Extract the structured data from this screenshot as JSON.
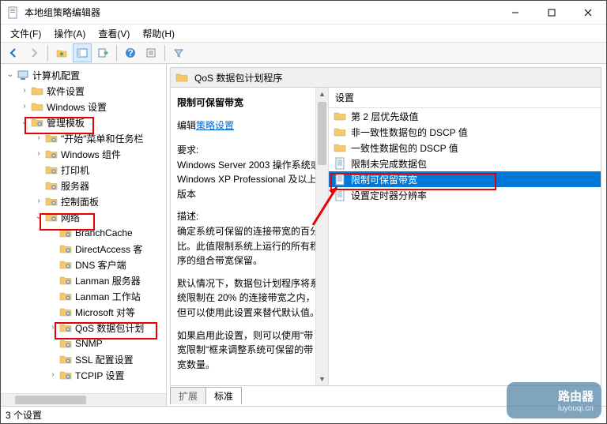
{
  "window": {
    "title": "本地组策略编辑器"
  },
  "menubar": {
    "file": "文件(F)",
    "action": "操作(A)",
    "view": "查看(V)",
    "help": "帮助(H)"
  },
  "tree": {
    "root": "计算机配置",
    "n_software": "软件设置",
    "n_windows": "Windows 设置",
    "n_templates": "管理模板",
    "n_start": "\"开始\"菜单和任务栏",
    "n_wincomp": "Windows 组件",
    "n_printers": "打印机",
    "n_servers": "服务器",
    "n_ctrlpanel": "控制面板",
    "n_network": "网络",
    "n_branch": "BranchCache",
    "n_direct": "DirectAccess 客",
    "n_dns": "DNS 客户端",
    "n_lanmans": "Lanman 服务器",
    "n_lanmanw": "Lanman 工作站",
    "n_mspair": "Microsoft 对等",
    "n_qos": "QoS 数据包计划",
    "n_snmp": "SNMP",
    "n_ssl": "SSL 配置设置",
    "n_tcpip": "TCPIP 设置"
  },
  "content": {
    "header": "QoS 数据包计划程序",
    "title": "限制可保留带宽",
    "editPrefix": "编辑",
    "editLink": "策略设置",
    "reqLabel": "要求:",
    "reqText": "Windows Server 2003 操作系统或 Windows XP Professional 及以上版本",
    "descLabel": "描述:",
    "descText": "确定系统可保留的连接带宽的百分比。此值限制系统上运行的所有程序的组合带宽保留。",
    "para2": "默认情况下，数据包计划程序将系统限制在 20% 的连接带宽之内，但可以使用此设置来替代默认值。",
    "para3": "如果启用此设置，则可以使用\"带宽限制\"框来调整系统可保留的带宽数量。"
  },
  "settings": {
    "header": "设置",
    "items": [
      {
        "label": "第 2 层优先级值",
        "kind": "folder"
      },
      {
        "label": "非一致性数据包的 DSCP 值",
        "kind": "folder"
      },
      {
        "label": "一致性数据包的 DSCP 值",
        "kind": "folder"
      },
      {
        "label": "限制未完成数据包",
        "kind": "doc"
      },
      {
        "label": "限制可保留带宽",
        "kind": "doc",
        "selected": true
      },
      {
        "label": "设置定时器分辨率",
        "kind": "doc"
      }
    ]
  },
  "tabs": {
    "extend": "扩展",
    "standard": "标准"
  },
  "status": "3 个设置",
  "watermark": {
    "main": "路由器",
    "sub": "luyouqi.cn"
  }
}
